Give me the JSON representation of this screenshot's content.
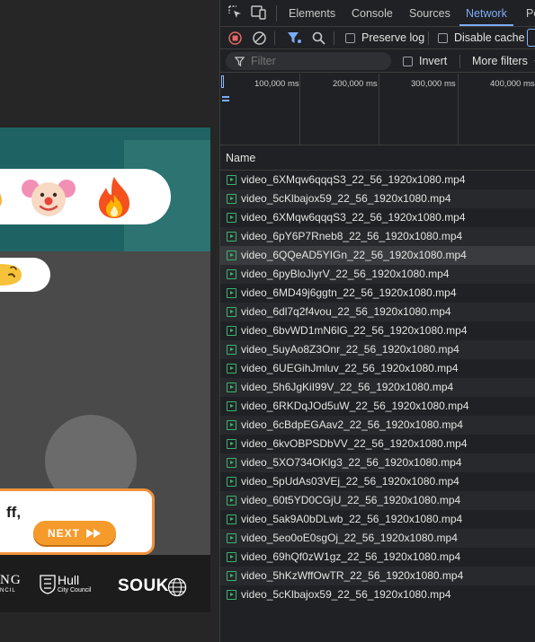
{
  "page": {
    "card_text": "ff,",
    "next_label": "NEXT",
    "footer_logos": {
      "partial": "NG",
      "partial_sub": "NCIL",
      "hull": "Hull",
      "hull_sub": "City Council",
      "souk": "SOUK"
    }
  },
  "devtools": {
    "tabs": [
      "Elements",
      "Console",
      "Sources",
      "Network",
      "Pe"
    ],
    "active_tab": "Network",
    "toolbar": {
      "preserve_log": "Preserve log",
      "disable_cache": "Disable cache"
    },
    "filter": {
      "placeholder": "Filter",
      "invert": "Invert",
      "more_filters": "More filters"
    },
    "timeline_ticks": [
      "100,000 ms",
      "200,000 ms",
      "300,000 ms",
      "400,000 ms"
    ],
    "column_header": "Name",
    "requests": [
      "video_6XMqw6qqqS3_22_56_1920x1080.mp4",
      "video_5cKlbajox59_22_56_1920x1080.mp4",
      "video_6XMqw6qqqS3_22_56_1920x1080.mp4",
      "video_6pY6P7Rneb8_22_56_1920x1080.mp4",
      "video_6QQeAD5YIGn_22_56_1920x1080.mp4",
      "video_6pyBloJiyrV_22_56_1920x1080.mp4",
      "video_6MD49j6ggtn_22_56_1920x1080.mp4",
      "video_6dl7q2f4vou_22_56_1920x1080.mp4",
      "video_6bvWD1mN6lG_22_56_1920x1080.mp4",
      "video_5uyAo8Z3Onr_22_56_1920x1080.mp4",
      "video_6UEGihJmluv_22_56_1920x1080.mp4",
      "video_5h6JgKiI99V_22_56_1920x1080.mp4",
      "video_6RKDqJOd5uW_22_56_1920x1080.mp4",
      "video_6cBdpEGAav2_22_56_1920x1080.mp4",
      "video_6kvOBPSDbVV_22_56_1920x1080.mp4",
      "video_5XO734OKlg3_22_56_1920x1080.mp4",
      "video_5pUdAs03VEj_22_56_1920x1080.mp4",
      "video_60t5YD0CGjU_22_56_1920x1080.mp4",
      "video_5ak9A0bDLwb_22_56_1920x1080.mp4",
      "video_5eo0oE0sgOj_22_56_1920x1080.mp4",
      "video_69hQf0zW1gz_22_56_1920x1080.mp4",
      "video_5hKzWffOwTR_22_56_1920x1080.mp4",
      "video_5cKlbajox59_22_56_1920x1080.mp4"
    ],
    "selected_index": 4,
    "colors": {
      "accent": "#7cacf8",
      "record": "#e46962",
      "file_icon": "#3cb371"
    }
  }
}
